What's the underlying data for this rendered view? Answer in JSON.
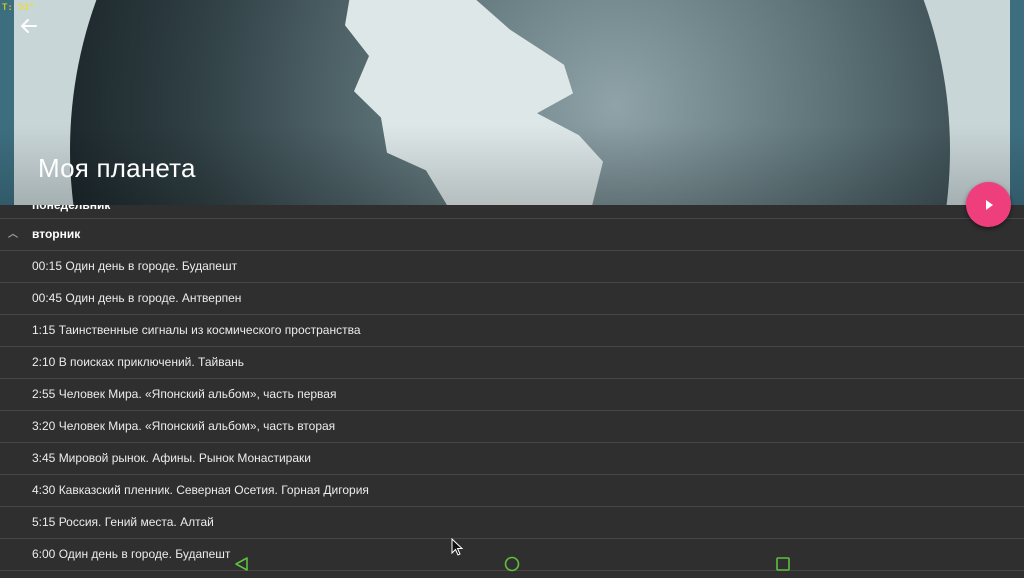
{
  "debug_overlay": "T: 53°",
  "header": {
    "title": "Моя планета",
    "back_icon": "arrow-back-icon"
  },
  "fab": {
    "icon": "play-icon",
    "color": "#ee3f7c"
  },
  "schedule": {
    "prev_day": "понедельник",
    "current_day": "вторник",
    "programs": [
      "00:15 Один день в городе. Будапешт",
      "00:45 Один день в городе. Антверпен",
      "1:15 Таинственные сигналы из космического пространства",
      "2:10 В поисках приключений. Тайвань",
      "2:55 Человек Мира. «Японский альбом», часть первая",
      "3:20 Человек Мира. «Японский альбом», часть вторая",
      "3:45 Мировой рынок. Афины. Рынок Монастираки",
      "4:30 Кавказский пленник. Северная Осетия. Горная Дигория",
      "5:15 Россия. Гений места. Алтай",
      "6:00 Один день в городе. Будапешт"
    ]
  },
  "navbar": {
    "back": "nav-back-icon",
    "home": "nav-home-icon",
    "recents": "nav-recents-icon",
    "color": "#5fbf3f"
  }
}
